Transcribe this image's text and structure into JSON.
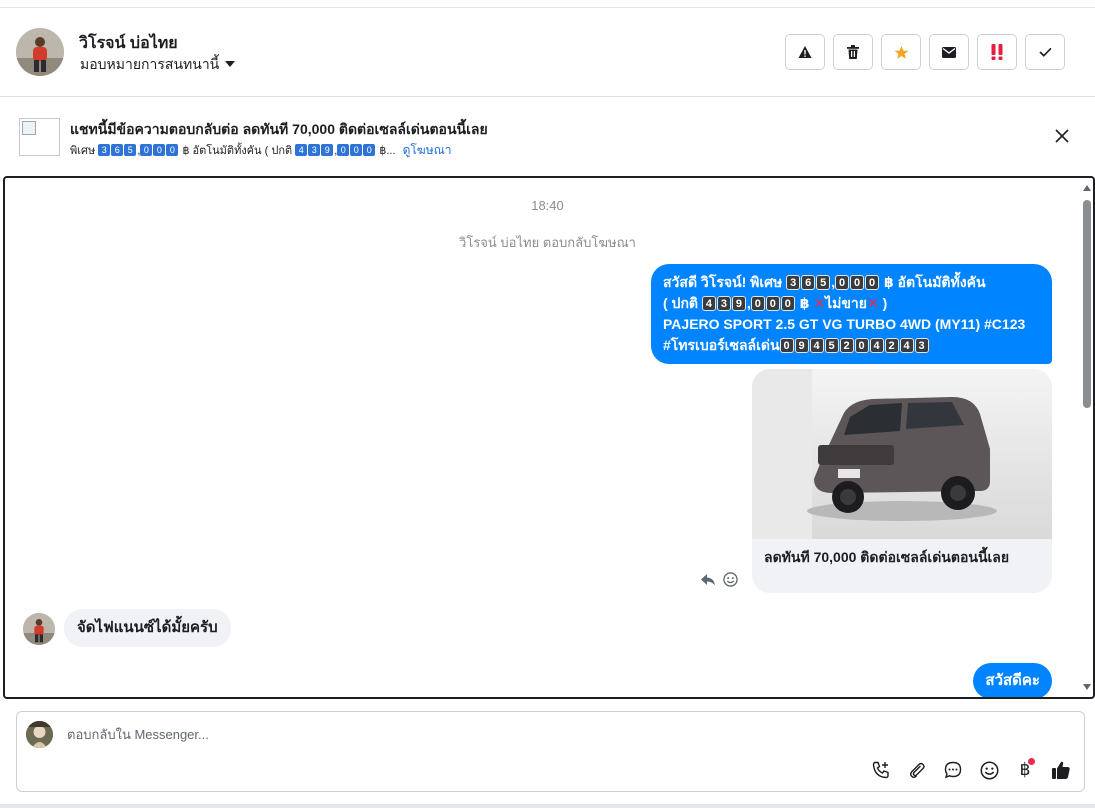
{
  "header": {
    "contact_name": "วิโรจน์ บ่อไทย",
    "assign_label": "มอบหมายการสนทนานี้",
    "actions": [
      "warning-icon",
      "trash-icon",
      "star-icon",
      "envelope-icon",
      "urgent-icon",
      "check-icon"
    ],
    "colors": {
      "star": "#f5a623",
      "urgent": "#e41e3f"
    }
  },
  "ad": {
    "title": "แชทนี้มีข้อความตอบกลับต่อ ลดทันที 70,000 ติดต่อเซลล์เด่นตอนนี้เลย",
    "sub_prefix": "พิเศษ",
    "sub_price": [
      "3",
      "6",
      "5",
      ",",
      "0",
      "0",
      "0"
    ],
    "sub_mid": "฿ อัตโนมัติทั้งคัน ( ปกติ",
    "sub_normal": [
      "4",
      "3",
      "9",
      ",",
      "0",
      "0",
      "0"
    ],
    "sub_suffix": "฿...",
    "link": "ดูโฆษณา"
  },
  "chat": {
    "timestamp": "18:40",
    "system_note": "วิโรจน์ บ่อไทย ตอบกลับโฆษณา",
    "msg1": {
      "greet": "สวัสดี วิโรจน์! พิเศษ",
      "price_digits": [
        "3",
        "6",
        "5",
        ",",
        "0",
        "0",
        "0"
      ],
      "after_price": "฿ อัตโนมัติทั้งคัน",
      "normal_prefix": "( ปกติ",
      "normal_digits": [
        "4",
        "3",
        "9",
        ",",
        "0",
        "0",
        "0"
      ],
      "normal_suffix": "฿",
      "not_sell": "ไม่ขาย",
      "close_paren": ")",
      "model": "PAJERO SPORT 2.5 GT VG TURBO 4WD (MY11) #C123",
      "phone_label": "#โทรเบอร์เซลล์เด่น",
      "phone_digits": [
        "0",
        "9",
        "4",
        "5",
        "2",
        "0",
        "4",
        "2",
        "4",
        "3"
      ]
    },
    "card_caption": "ลดทันที 70,000  ติดต่อเซลล์เด่นตอนนี้เลย",
    "incoming": "จัดไฟแนนซ์ได้มั้ยครับ",
    "msg3": "สวัสดีคะ",
    "colors": {
      "outgoing": "#0084ff",
      "incoming": "#f0f2f5"
    }
  },
  "composer": {
    "placeholder": "ตอบกลับใน Messenger...",
    "tools": [
      "phone-plus-icon",
      "paperclip-icon",
      "chat-bubble-icon",
      "emoji-icon",
      "baht-icon",
      "thumbs-up-icon"
    ],
    "baht_symbol": "฿"
  }
}
